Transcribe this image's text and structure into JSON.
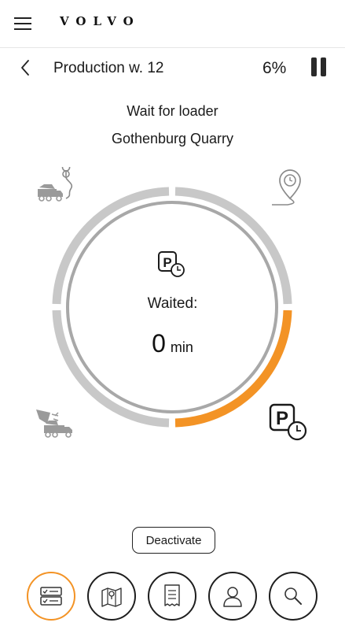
{
  "header": {
    "brand": "VOLVO",
    "menu_icon": "hamburger-menu-icon"
  },
  "subheader": {
    "back_icon": "chevron-left-icon",
    "title": "Production w. 12",
    "progress_text": "6%",
    "pause_icon": "pause-icon"
  },
  "status": {
    "line1": "Wait for loader",
    "line2": "Gothenburg Quarry"
  },
  "cycle": {
    "stages": [
      "loaded-haul",
      "unload",
      "empty-return",
      "wait-for-loader"
    ],
    "active_stage": "wait-for-loader",
    "waited_label": "Waited:",
    "waited_value": "0",
    "waited_unit": "min"
  },
  "actions": {
    "deactivate_label": "Deactivate"
  },
  "bottom_nav": {
    "items": [
      "checklist",
      "map",
      "receipt",
      "profile",
      "search"
    ],
    "active": "checklist"
  },
  "colors": {
    "accent": "#f39325",
    "ring_inactive": "#c8c8c8",
    "inner_ring": "#a8a8a8"
  }
}
